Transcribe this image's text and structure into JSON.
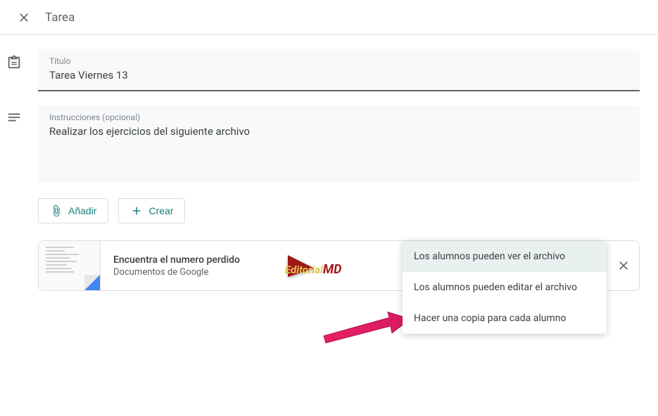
{
  "header": {
    "title": "Tarea"
  },
  "title_field": {
    "label": "Título",
    "value": "Tarea Viernes 13"
  },
  "instructions_field": {
    "label": "Instrucciones (opcional)",
    "value": "Realizar los ejercicios del siguiente archivo"
  },
  "buttons": {
    "add": "Añadir",
    "create": "Crear"
  },
  "attachment": {
    "title": "Encuentra el numero perdido",
    "type": "Documentos de Google"
  },
  "dropdown": {
    "options": [
      "Los alumnos pueden ver el archivo",
      "Los alumnos pueden editar el archivo",
      "Hacer una copia para cada alumno"
    ]
  },
  "watermark": {
    "text_a": "Editorial",
    "text_b": "MD"
  }
}
